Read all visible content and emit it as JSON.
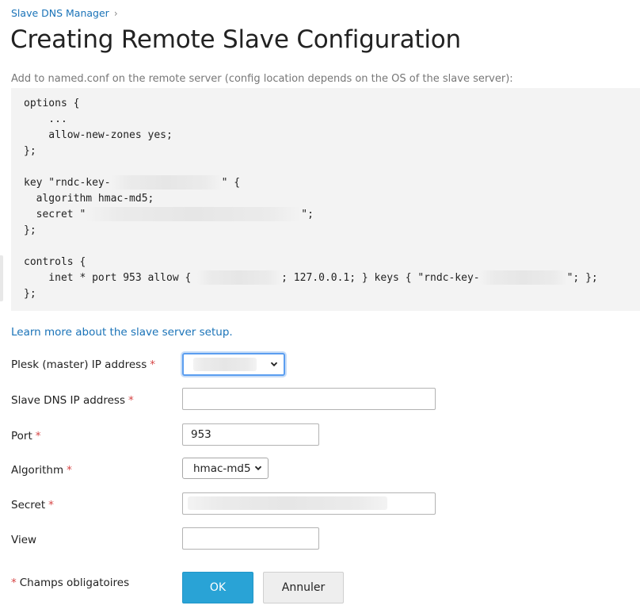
{
  "breadcrumb": {
    "parent": "Slave DNS Manager"
  },
  "page": {
    "title": "Creating Remote Slave Configuration",
    "hint": "Add to named.conf on the remote server (config location depends on the OS of the slave server):"
  },
  "code": {
    "l1": "options {",
    "l2": "    ...",
    "l3": "    allow-new-zones yes;",
    "l4": "};",
    "l5a": "key \"rndc-key-",
    "l5b": "\" {",
    "l6": "  algorithm hmac-md5;",
    "l7a": "  secret \"",
    "l7b": "\";",
    "l8": "};",
    "l9": "controls {",
    "l10a": "    inet * port 953 allow { ",
    "l10b": "; 127.0.0.1; } keys { \"rndc-key-",
    "l10c": "\"; };",
    "l11": "};"
  },
  "links": {
    "learn_more": "Learn more about the slave server setup."
  },
  "form": {
    "plesk_ip_label": "Plesk (master) IP address",
    "slave_ip_label": "Slave DNS IP address",
    "slave_ip_value": "",
    "port_label": "Port",
    "port_value": "953",
    "algorithm_label": "Algorithm",
    "algorithm_value": "hmac-md5",
    "secret_label": "Secret",
    "view_label": "View",
    "view_value": "",
    "required_marker": "*"
  },
  "footer": {
    "required_note": "Champs obligatoires",
    "ok_label": "OK",
    "cancel_label": "Annuler"
  },
  "icons": {
    "breadcrumb_separator": "chevron-right-icon",
    "select_arrow": "chevron-down-icon"
  },
  "colors": {
    "link": "#1a73b8",
    "required": "#d64545",
    "ok_button": "#29a3d6",
    "code_background": "#f3f3f3"
  }
}
